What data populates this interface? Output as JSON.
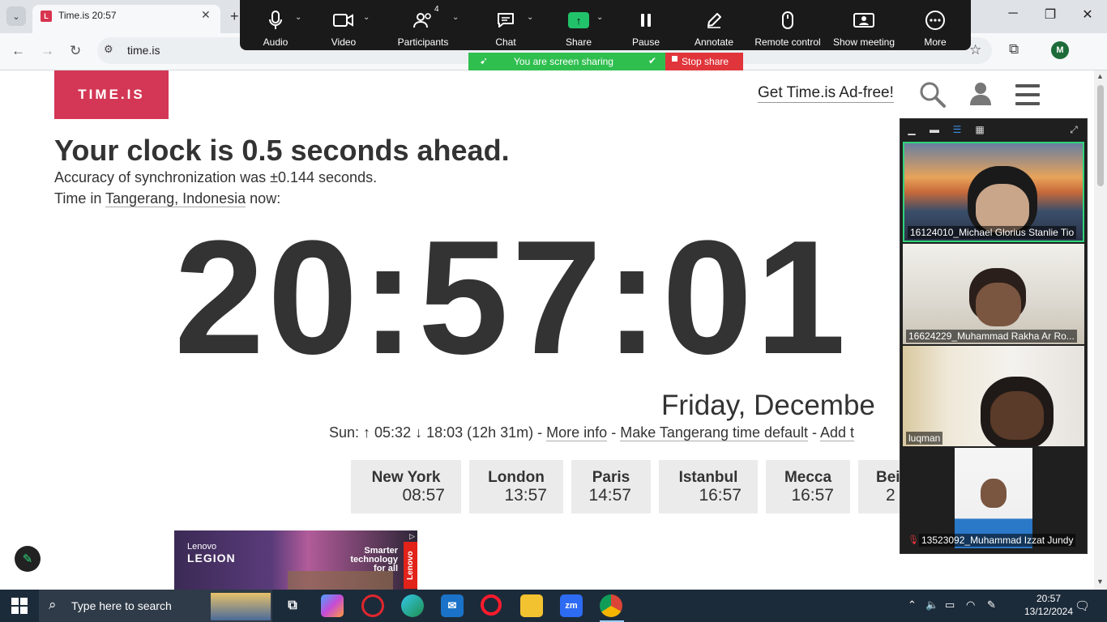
{
  "browser": {
    "tab_title": "Time.is 20:57",
    "favicon_letter": "L",
    "url": "time.is"
  },
  "zoom": {
    "toolbar": {
      "audio": "Audio",
      "video": "Video",
      "participants": "Participants",
      "participants_count": "4",
      "chat": "Chat",
      "share": "Share",
      "pause": "Pause",
      "annotate": "Annotate",
      "remote_control": "Remote control",
      "show_meeting": "Show meeting",
      "more": "More"
    },
    "sharing_banner": "You are screen sharing",
    "stop_share": "Stop share",
    "participants": [
      {
        "name": "16124010_Michael Glorius Stanlie Tio"
      },
      {
        "name": "16624229_Muhammad Rakha Ar Ro..."
      },
      {
        "name": "luqman"
      },
      {
        "name": "13523092_Muhammad Izzat Jundy"
      }
    ],
    "colors": {
      "active_speaker_border": "#2fd37a",
      "share_green": "#22c26a",
      "stop_red": "#e0353b"
    }
  },
  "page": {
    "logo": "TIME.IS",
    "ad_free": "Get Time.is Ad-free!",
    "headline": "Your clock is 0.5 seconds ahead.",
    "accuracy": "Accuracy of synchronization was ±0.144 seconds.",
    "time_in_prefix": "Time in ",
    "location": "Tangerang, Indonesia",
    "time_in_suffix": " now:",
    "clock": "20:57:01",
    "date": "Friday, Decembe",
    "sun_prefix": "Sun: ↑ 05:32 ↓ 18:03 (12h 31m) - ",
    "more_info": "More info",
    "sep": " - ",
    "make_default": "Make Tangerang time default",
    "add": "Add t",
    "cities": [
      {
        "name": "New York",
        "time": "08:57"
      },
      {
        "name": "London",
        "time": "13:57"
      },
      {
        "name": "Paris",
        "time": "14:57"
      },
      {
        "name": "Istanbul",
        "time": "16:57"
      },
      {
        "name": "Mecca",
        "time": "16:57"
      },
      {
        "name": "Bei",
        "time": "2"
      }
    ],
    "ad": {
      "brand_top": "Lenovo",
      "brand": "LEGION",
      "tagline": "Smarter technology for all",
      "side": "Lenovo"
    },
    "brand_color": "#d33755"
  },
  "taskbar": {
    "search_placeholder": "Type here to search",
    "time": "20:57",
    "date": "13/12/2024"
  }
}
